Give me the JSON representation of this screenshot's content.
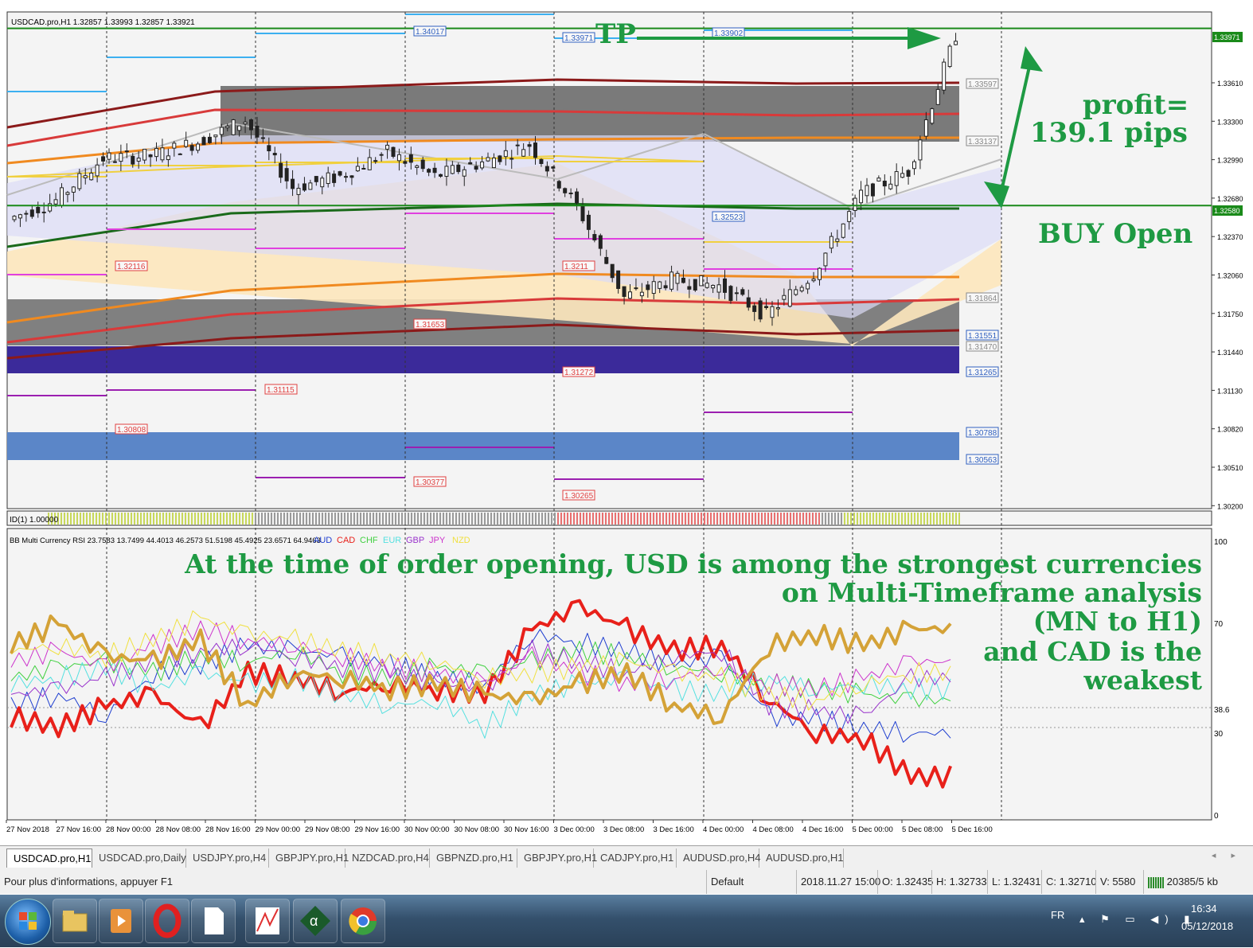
{
  "window": {
    "chart_header": "USDCAD.pro,H1  1.32857 1.33993 1.32857 1.33921",
    "indicator_label": "ID(1) 1.00000",
    "rsi_header": "BB Multi Currency RSI 23.7583 13.7499 44.4013 46.2573 51.5198 45.4925 23.6571 64.9463",
    "rsi_legend": [
      {
        "label": "AUD",
        "color": "#1f3fd0"
      },
      {
        "label": "CAD",
        "color": "#e8201a"
      },
      {
        "label": "CHF",
        "color": "#3fd03f"
      },
      {
        "label": "EUR",
        "color": "#55e0e0"
      },
      {
        "label": "GBP",
        "color": "#9933cc"
      },
      {
        "label": "JPY",
        "color": "#cc33cc"
      },
      {
        "label": "NZD",
        "color": "#f0e040"
      }
    ]
  },
  "price_axis": {
    "ticks": [
      "1.33610",
      "1.33300",
      "1.32990",
      "1.32680",
      "1.32370",
      "1.32060",
      "1.31750",
      "1.31440",
      "1.31130",
      "1.30820",
      "1.30510",
      "1.30200"
    ],
    "current_price_1": "1.33971",
    "current_price_2": "1.32580"
  },
  "rsi_axis": {
    "ticks": [
      "100",
      "70",
      "38.6",
      "30",
      "0"
    ]
  },
  "time_axis": {
    "ticks": [
      "27 Nov 2018",
      "27 Nov 16:00",
      "28 Nov 00:00",
      "28 Nov 08:00",
      "28 Nov 16:00",
      "29 Nov 00:00",
      "29 Nov 08:00",
      "29 Nov 16:00",
      "30 Nov 00:00",
      "30 Nov 08:00",
      "30 Nov 16:00",
      "3 Dec 00:00",
      "3 Dec 08:00",
      "3 Dec 16:00",
      "4 Dec 00:00",
      "4 Dec 08:00",
      "4 Dec 16:00",
      "5 Dec 00:00",
      "5 Dec 08:00",
      "5 Dec 16:00"
    ]
  },
  "level_labels": [
    {
      "text": "1.34017",
      "color": "#3060c0"
    },
    {
      "text": "1.33971",
      "color": "#3060c0"
    },
    {
      "text": "1.33902",
      "color": "#3060c0"
    },
    {
      "text": "1.33597",
      "color": "#888888"
    },
    {
      "text": "1.33137",
      "color": "#888888"
    },
    {
      "text": "1.32523",
      "color": "#3060c0"
    },
    {
      "text": "1.32116",
      "color": "#e04040"
    },
    {
      "text": "1.3211",
      "color": "#e04040"
    },
    {
      "text": "1.31864",
      "color": "#888888"
    },
    {
      "text": "1.31653",
      "color": "#e04040"
    },
    {
      "text": "1.31551",
      "color": "#3060c0"
    },
    {
      "text": "1.31470",
      "color": "#888888"
    },
    {
      "text": "1.31272",
      "color": "#e04040"
    },
    {
      "text": "1.31265",
      "color": "#3060c0"
    },
    {
      "text": "1.31115",
      "color": "#e04040"
    },
    {
      "text": "1.30808",
      "color": "#e04040"
    },
    {
      "text": "1.30788",
      "color": "#3060c0"
    },
    {
      "text": "1.30563",
      "color": "#3060c0"
    },
    {
      "text": "1.30377",
      "color": "#e04040"
    },
    {
      "text": "1.30265",
      "color": "#e04040"
    }
  ],
  "annotations": {
    "tp": "TP",
    "profit_line1": "profit=",
    "profit_line2": "139.1 pips",
    "buy_open": "BUY Open",
    "rsi_note": [
      "At the time of order opening, USD is among the strongest currencies",
      "on Multi-Timeframe analysis",
      "(MN to H1)",
      "and CAD is the",
      "weakest"
    ],
    "color": "#1e9a43"
  },
  "tabs": [
    {
      "label": "USDCAD.pro,H1",
      "active": true
    },
    {
      "label": "USDCAD.pro,Daily",
      "active": false
    },
    {
      "label": "USDJPY.pro,H4",
      "active": false
    },
    {
      "label": "GBPJPY.pro,H1",
      "active": false
    },
    {
      "label": "NZDCAD.pro,H4",
      "active": false
    },
    {
      "label": "GBPNZD.pro,H1",
      "active": false
    },
    {
      "label": "GBPJPY.pro,H1",
      "active": false
    },
    {
      "label": "CADJPY.pro,H1",
      "active": false
    },
    {
      "label": "AUDUSD.pro,H4",
      "active": false
    },
    {
      "label": "AUDUSD.pro,H1",
      "active": false
    }
  ],
  "status": {
    "help": "Pour plus d'informations, appuyer F1",
    "profile": "Default",
    "datetime": "2018.11.27 15:00",
    "open": "O: 1.32435",
    "high": "H: 1.32733",
    "low": "L: 1.32431",
    "close": "C: 1.32710",
    "volume": "V: 5580",
    "traffic": "20385/5 kb"
  },
  "taskbar": {
    "language": "FR",
    "time": "16:34",
    "date": "05/12/2018",
    "apps": [
      "windows-start",
      "file-explorer",
      "media-player",
      "opera-browser",
      "document",
      "chart-app",
      "alpha-app",
      "chrome-browser"
    ]
  },
  "chart_data": [
    {
      "type": "candlestick",
      "title": "USDCAD.pro,H1",
      "x": [
        "27 Nov 2018",
        "27 Nov 16:00",
        "28 Nov 00:00",
        "28 Nov 08:00",
        "28 Nov 16:00",
        "29 Nov 00:00",
        "29 Nov 08:00",
        "29 Nov 16:00",
        "30 Nov 00:00",
        "30 Nov 08:00",
        "30 Nov 16:00",
        "3 Dec 00:00",
        "3 Dec 08:00",
        "3 Dec 16:00",
        "4 Dec 00:00",
        "4 Dec 08:00",
        "4 Dec 16:00",
        "5 Dec 00:00",
        "5 Dec 08:00",
        "5 Dec 16:00"
      ],
      "close": [
        1.3262,
        1.3295,
        1.3297,
        1.3308,
        1.3325,
        1.3272,
        1.3281,
        1.33,
        1.3281,
        1.3292,
        1.3306,
        1.3258,
        1.3186,
        1.32,
        1.3195,
        1.3172,
        1.3205,
        1.3267,
        1.3285,
        1.3392
      ],
      "ylim": [
        1.302,
        1.341
      ],
      "tp_level": 1.33971,
      "buy_open_level": 1.3258
    },
    {
      "type": "line",
      "title": "BB Multi Currency RSI",
      "x": [
        "27 Nov 2018",
        "27 Nov 16:00",
        "28 Nov 00:00",
        "28 Nov 08:00",
        "28 Nov 16:00",
        "29 Nov 00:00",
        "29 Nov 08:00",
        "29 Nov 16:00",
        "30 Nov 00:00",
        "30 Nov 08:00",
        "30 Nov 16:00",
        "3 Dec 00:00",
        "3 Dec 08:00",
        "3 Dec 16:00",
        "4 Dec 00:00",
        "4 Dec 08:00",
        "4 Dec 16:00",
        "5 Dec 00:00",
        "5 Dec 08:00",
        "5 Dec 16:00"
      ],
      "ylim": [
        0,
        100
      ],
      "series": [
        {
          "name": "AUD",
          "color": "#1f3fd0",
          "width": 1,
          "values": [
            40,
            44,
            36,
            52,
            55,
            62,
            60,
            58,
            55,
            50,
            48,
            66,
            63,
            60,
            55,
            58,
            36,
            35,
            32,
            30
          ]
        },
        {
          "name": "CAD",
          "color": "#e8201a",
          "width": 4,
          "values": [
            36,
            32,
            40,
            44,
            32,
            52,
            50,
            45,
            48,
            46,
            44,
            68,
            76,
            68,
            60,
            62,
            42,
            30,
            28,
            14
          ]
        },
        {
          "name": "CHF",
          "color": "#3fd03f",
          "width": 1,
          "values": [
            50,
            54,
            56,
            52,
            58,
            56,
            60,
            52,
            50,
            54,
            52,
            56,
            60,
            58,
            54,
            52,
            48,
            46,
            44,
            42
          ]
        },
        {
          "name": "EUR",
          "color": "#55e0e0",
          "width": 1,
          "values": [
            48,
            50,
            54,
            46,
            52,
            48,
            50,
            44,
            40,
            42,
            32,
            44,
            48,
            50,
            46,
            44,
            50,
            46,
            48,
            46
          ]
        },
        {
          "name": "GBP",
          "color": "#9933cc",
          "width": 1,
          "values": [
            44,
            46,
            50,
            56,
            60,
            62,
            58,
            54,
            52,
            48,
            46,
            60,
            56,
            52,
            58,
            60,
            40,
            38,
            36,
            50
          ]
        },
        {
          "name": "JPY",
          "color": "#cc33cc",
          "width": 1,
          "values": [
            56,
            60,
            54,
            62,
            68,
            64,
            62,
            58,
            54,
            52,
            48,
            58,
            52,
            48,
            50,
            54,
            48,
            46,
            50,
            56
          ]
        },
        {
          "name": "NZD",
          "color": "#f0e040",
          "width": 1,
          "values": [
            60,
            62,
            58,
            64,
            72,
            66,
            64,
            60,
            58,
            56,
            50,
            52,
            54,
            56,
            52,
            50,
            44,
            42,
            48,
            52
          ]
        },
        {
          "name": "USD",
          "color": "#d4a237",
          "width": 4,
          "values": [
            62,
            70,
            58,
            56,
            64,
            40,
            52,
            50,
            46,
            48,
            44,
            42,
            48,
            52,
            40,
            36,
            62,
            66,
            62,
            68
          ]
        }
      ]
    }
  ]
}
